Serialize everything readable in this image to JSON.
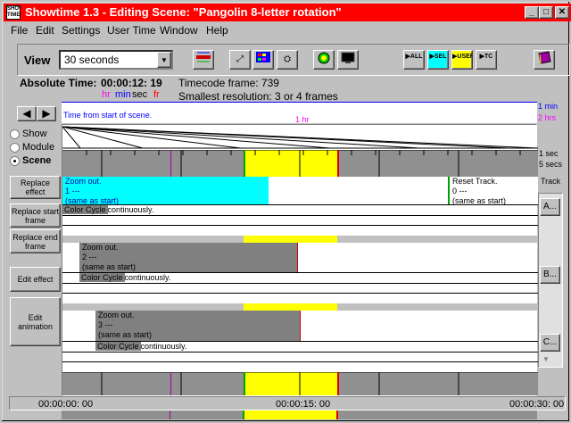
{
  "window": {
    "app_icon_text": "SHOW TIME",
    "title": "Showtime 1.3 - Editing Scene: \"Pangolin 8-letter rotation\"",
    "minimize": "_",
    "maximize": "□",
    "close": "✕"
  },
  "menu": [
    "File",
    "Edit",
    "Settings",
    "User Time",
    "Window",
    "Help"
  ],
  "menu_accel": [
    "F",
    "E",
    "S",
    "U",
    "W",
    "H"
  ],
  "toolbar": {
    "view_label": "View",
    "view_value": "30 seconds",
    "btn_all": "▶ALL",
    "btn_sel": "▶SEL",
    "btn_user": "▶USER",
    "btn_tc": "▶TC"
  },
  "info": {
    "absolute_time_label": "Absolute Time:",
    "absolute_time_value": "00:00:12: 19",
    "unit_hr": "hr",
    "unit_min": "min",
    "unit_sec": "sec",
    "unit_fr": "fr",
    "timecode_frame": "Timecode frame: 739",
    "smallest_resolution": "Smallest resolution:  3 or 4 frames"
  },
  "scale": {
    "time_from_start": "Time from start of scene.",
    "one_hr": "1 hr",
    "one_min": "1 min",
    "two_hrs": "2 hrs",
    "one_sec": "1 sec",
    "five_secs": "5 secs"
  },
  "mode": {
    "show": "Show",
    "module": "Module",
    "scene": "Scene",
    "selected": "scene"
  },
  "side_buttons": {
    "replace_effect": "Replace effect",
    "replace_start_frame": "Replace start frame",
    "replace_end_frame": "Replace end frame",
    "edit_effect": "Edit effect",
    "edit_animation": "Edit animation"
  },
  "tracks": {
    "label": "Track",
    "a": "A...",
    "b": "B...",
    "c": "C..."
  },
  "effects": {
    "track_a_zoom": [
      "Zoom out.",
      "1 ---",
      "(same as start)"
    ],
    "track_a_reset": [
      "Reset Track.",
      "0 ---",
      "(same as start)"
    ],
    "track_b_zoom": [
      "Zoom out.",
      "2 ---",
      "(same as start)"
    ],
    "track_c_zoom": [
      "Zoom out.",
      "3 ---",
      "(same as start)"
    ],
    "color_cycle": "Color Cycle",
    "continuously": "continuously."
  },
  "bottom_times": {
    "start": "00:00:00: 00",
    "mid": "00:00:15: 00",
    "end": "00:00:30: 00"
  },
  "colors": {
    "titlebar": "#ff0000",
    "highlight": "#ffff00",
    "cyan_effect": "#00ffff",
    "gray_effect": "#808080"
  }
}
